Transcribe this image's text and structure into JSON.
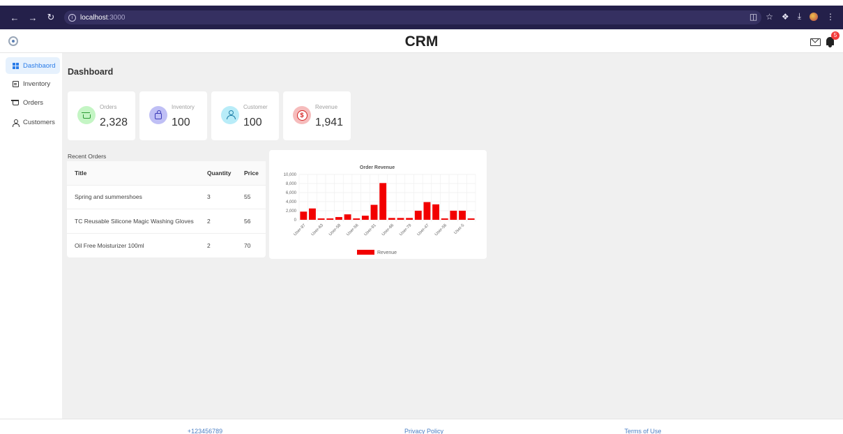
{
  "browser": {
    "url_host": "localhost",
    "url_port": ":3000"
  },
  "app": {
    "title": "CRM",
    "notification_count": "5"
  },
  "sidebar": {
    "items": [
      {
        "label": "Dashbaord",
        "icon": "grid-icon",
        "active": true
      },
      {
        "label": "Inventory",
        "icon": "inventory-icon",
        "active": false
      },
      {
        "label": "Orders",
        "icon": "cart-icon",
        "active": false
      },
      {
        "label": "Customers",
        "icon": "user-icon",
        "active": false
      }
    ]
  },
  "page": {
    "title": "Dashboard"
  },
  "stats": [
    {
      "label": "Orders",
      "value": "2,328",
      "icon": "cart-icon",
      "bg": "#c4f5c4"
    },
    {
      "label": "Inventory",
      "value": "100",
      "icon": "bag-icon",
      "bg": "#bfbff5"
    },
    {
      "label": "Customer",
      "value": "100",
      "icon": "user-icon",
      "bg": "#b8ecf8"
    },
    {
      "label": "Revenue",
      "value": "1,941",
      "icon": "dollar-icon",
      "bg": "#f6bcbc"
    }
  ],
  "recent_orders": {
    "label": "Recent Orders",
    "columns": [
      "Title",
      "Quantity",
      "Price"
    ],
    "rows": [
      {
        "title": "Spring and summershoes",
        "quantity": "3",
        "price": "55"
      },
      {
        "title": "TC Reusable Silicone Magic Washing Gloves",
        "quantity": "2",
        "price": "56"
      },
      {
        "title": "Oil Free Moisturizer 100ml",
        "quantity": "2",
        "price": "70"
      }
    ]
  },
  "chart_data": {
    "type": "bar",
    "title": "Order Revenue",
    "xlabel": "",
    "ylabel": "",
    "ylim": [
      0,
      10000
    ],
    "yticks": [
      "0",
      "2,000",
      "4,000",
      "6,000",
      "8,000",
      "10,000"
    ],
    "xtick_labels": [
      "User-97",
      "User-63",
      "User-58",
      "User-56",
      "User-91",
      "User-66",
      "User-79",
      "User-47",
      "User-56",
      "User-5"
    ],
    "grid": true,
    "legend": "bottom",
    "series": [
      {
        "name": "Revenue",
        "color": "#f20000",
        "values": [
          1800,
          2500,
          300,
          300,
          600,
          1200,
          300,
          900,
          3300,
          8100,
          400,
          400,
          400,
          2000,
          3900,
          3400,
          300,
          2000,
          2000,
          300
        ]
      }
    ]
  },
  "footer": {
    "phone": "+123456789",
    "privacy": "Privacy Policy",
    "terms": "Terms of Use"
  }
}
